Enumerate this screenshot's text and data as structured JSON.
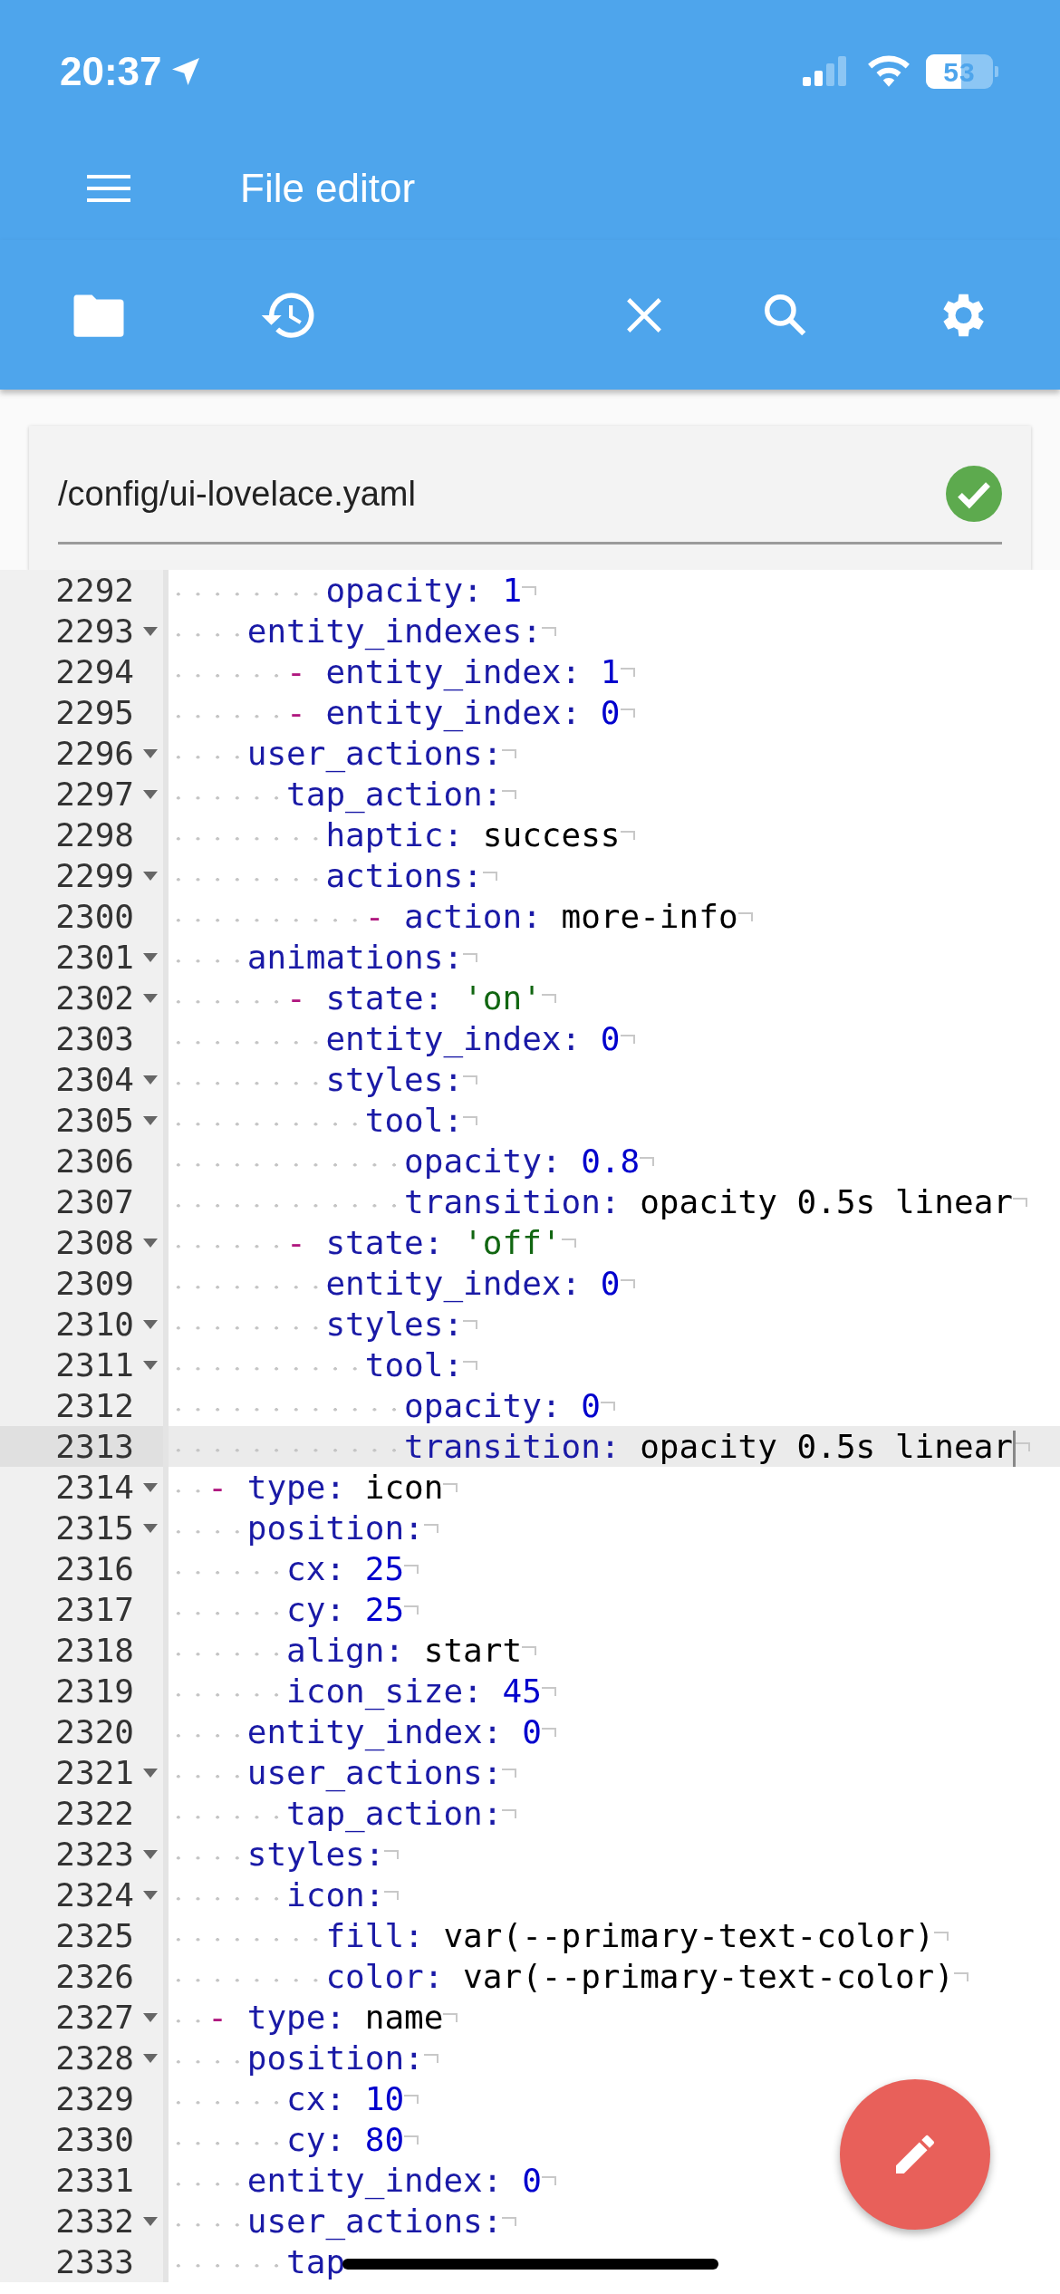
{
  "status_bar": {
    "time": "20:37",
    "battery": "53"
  },
  "app_bar": {
    "title": "File editor"
  },
  "file": {
    "path": "/config/ui-lovelace.yaml",
    "valid": true
  },
  "editor": {
    "lines": [
      {
        "number": "2292",
        "fold": false,
        "active": false,
        "tokens": [
          {
            "kind": "key",
            "text": "        opacity:"
          },
          {
            "kind": "number",
            "text": " 1"
          }
        ]
      },
      {
        "number": "2293",
        "fold": true,
        "active": false,
        "tokens": [
          {
            "kind": "key",
            "text": "    entity_indexes:"
          }
        ]
      },
      {
        "number": "2294",
        "fold": false,
        "active": false,
        "tokens": [
          {
            "kind": "dash",
            "text": "      - "
          },
          {
            "kind": "key",
            "text": "entity_index:"
          },
          {
            "kind": "number",
            "text": " 1"
          }
        ]
      },
      {
        "number": "2295",
        "fold": false,
        "active": false,
        "tokens": [
          {
            "kind": "dash",
            "text": "      - "
          },
          {
            "kind": "key",
            "text": "entity_index:"
          },
          {
            "kind": "number",
            "text": " 0"
          }
        ]
      },
      {
        "number": "2296",
        "fold": true,
        "active": false,
        "tokens": [
          {
            "kind": "key",
            "text": "    user_actions:"
          }
        ]
      },
      {
        "number": "2297",
        "fold": true,
        "active": false,
        "tokens": [
          {
            "kind": "key",
            "text": "      tap_action:"
          }
        ]
      },
      {
        "number": "2298",
        "fold": false,
        "active": false,
        "tokens": [
          {
            "kind": "key",
            "text": "        haptic:"
          },
          {
            "kind": "plain",
            "text": " success"
          }
        ]
      },
      {
        "number": "2299",
        "fold": true,
        "active": false,
        "tokens": [
          {
            "kind": "key",
            "text": "        actions:"
          }
        ]
      },
      {
        "number": "2300",
        "fold": false,
        "active": false,
        "tokens": [
          {
            "kind": "dash",
            "text": "          - "
          },
          {
            "kind": "key",
            "text": "action:"
          },
          {
            "kind": "plain",
            "text": " more-info"
          }
        ]
      },
      {
        "number": "2301",
        "fold": true,
        "active": false,
        "tokens": [
          {
            "kind": "key",
            "text": "    animations:"
          }
        ]
      },
      {
        "number": "2302",
        "fold": true,
        "active": false,
        "tokens": [
          {
            "kind": "dash",
            "text": "      - "
          },
          {
            "kind": "key",
            "text": "state:"
          },
          {
            "kind": "string",
            "text": " 'on'"
          }
        ]
      },
      {
        "number": "2303",
        "fold": false,
        "active": false,
        "tokens": [
          {
            "kind": "key",
            "text": "        entity_index:"
          },
          {
            "kind": "number",
            "text": " 0"
          }
        ]
      },
      {
        "number": "2304",
        "fold": true,
        "active": false,
        "tokens": [
          {
            "kind": "key",
            "text": "        styles:"
          }
        ]
      },
      {
        "number": "2305",
        "fold": true,
        "active": false,
        "tokens": [
          {
            "kind": "key",
            "text": "          tool:"
          }
        ]
      },
      {
        "number": "2306",
        "fold": false,
        "active": false,
        "tokens": [
          {
            "kind": "key",
            "text": "            opacity:"
          },
          {
            "kind": "number",
            "text": " 0.8"
          }
        ]
      },
      {
        "number": "2307",
        "fold": false,
        "active": false,
        "tokens": [
          {
            "kind": "key",
            "text": "            transition:"
          },
          {
            "kind": "plain",
            "text": " opacity 0.5s linear"
          }
        ]
      },
      {
        "number": "2308",
        "fold": true,
        "active": false,
        "tokens": [
          {
            "kind": "dash",
            "text": "      - "
          },
          {
            "kind": "key",
            "text": "state:"
          },
          {
            "kind": "string",
            "text": " 'off'"
          }
        ]
      },
      {
        "number": "2309",
        "fold": false,
        "active": false,
        "tokens": [
          {
            "kind": "key",
            "text": "        entity_index:"
          },
          {
            "kind": "number",
            "text": " 0"
          }
        ]
      },
      {
        "number": "2310",
        "fold": true,
        "active": false,
        "tokens": [
          {
            "kind": "key",
            "text": "        styles:"
          }
        ]
      },
      {
        "number": "2311",
        "fold": true,
        "active": false,
        "tokens": [
          {
            "kind": "key",
            "text": "          tool:"
          }
        ]
      },
      {
        "number": "2312",
        "fold": false,
        "active": false,
        "tokens": [
          {
            "kind": "key",
            "text": "            opacity:"
          },
          {
            "kind": "number",
            "text": " 0"
          }
        ]
      },
      {
        "number": "2313",
        "fold": false,
        "active": true,
        "tokens": [
          {
            "kind": "key",
            "text": "            transition:"
          },
          {
            "kind": "plain",
            "text": " opacity 0.5s linear"
          }
        ]
      },
      {
        "number": "2314",
        "fold": true,
        "active": false,
        "tokens": [
          {
            "kind": "dash",
            "text": "  - "
          },
          {
            "kind": "key",
            "text": "type:"
          },
          {
            "kind": "plain",
            "text": " icon"
          }
        ]
      },
      {
        "number": "2315",
        "fold": true,
        "active": false,
        "tokens": [
          {
            "kind": "key",
            "text": "    position:"
          }
        ]
      },
      {
        "number": "2316",
        "fold": false,
        "active": false,
        "tokens": [
          {
            "kind": "key",
            "text": "      cx:"
          },
          {
            "kind": "number",
            "text": " 25"
          }
        ]
      },
      {
        "number": "2317",
        "fold": false,
        "active": false,
        "tokens": [
          {
            "kind": "key",
            "text": "      cy:"
          },
          {
            "kind": "number",
            "text": " 25"
          }
        ]
      },
      {
        "number": "2318",
        "fold": false,
        "active": false,
        "tokens": [
          {
            "kind": "key",
            "text": "      align:"
          },
          {
            "kind": "plain",
            "text": " start"
          }
        ]
      },
      {
        "number": "2319",
        "fold": false,
        "active": false,
        "tokens": [
          {
            "kind": "key",
            "text": "      icon_size:"
          },
          {
            "kind": "number",
            "text": " 45"
          }
        ]
      },
      {
        "number": "2320",
        "fold": false,
        "active": false,
        "tokens": [
          {
            "kind": "key",
            "text": "    entity_index:"
          },
          {
            "kind": "number",
            "text": " 0"
          }
        ]
      },
      {
        "number": "2321",
        "fold": true,
        "active": false,
        "tokens": [
          {
            "kind": "key",
            "text": "    user_actions:"
          }
        ]
      },
      {
        "number": "2322",
        "fold": false,
        "active": false,
        "tokens": [
          {
            "kind": "key",
            "text": "      tap_action:"
          }
        ]
      },
      {
        "number": "2323",
        "fold": true,
        "active": false,
        "tokens": [
          {
            "kind": "key",
            "text": "    styles:"
          }
        ]
      },
      {
        "number": "2324",
        "fold": true,
        "active": false,
        "tokens": [
          {
            "kind": "key",
            "text": "      icon:"
          }
        ]
      },
      {
        "number": "2325",
        "fold": false,
        "active": false,
        "tokens": [
          {
            "kind": "key",
            "text": "        fill:"
          },
          {
            "kind": "plain",
            "text": " var(--primary-text-color)"
          }
        ]
      },
      {
        "number": "2326",
        "fold": false,
        "active": false,
        "tokens": [
          {
            "kind": "key",
            "text": "        color:"
          },
          {
            "kind": "plain",
            "text": " var(--primary-text-color)"
          }
        ]
      },
      {
        "number": "2327",
        "fold": true,
        "active": false,
        "tokens": [
          {
            "kind": "dash",
            "text": "  - "
          },
          {
            "kind": "key",
            "text": "type:"
          },
          {
            "kind": "plain",
            "text": " name"
          }
        ]
      },
      {
        "number": "2328",
        "fold": true,
        "active": false,
        "tokens": [
          {
            "kind": "key",
            "text": "    position:"
          }
        ]
      },
      {
        "number": "2329",
        "fold": false,
        "active": false,
        "tokens": [
          {
            "kind": "key",
            "text": "      cx:"
          },
          {
            "kind": "number",
            "text": " 10"
          }
        ]
      },
      {
        "number": "2330",
        "fold": false,
        "active": false,
        "tokens": [
          {
            "kind": "key",
            "text": "      cy:"
          },
          {
            "kind": "number",
            "text": " 80"
          }
        ]
      },
      {
        "number": "2331",
        "fold": false,
        "active": false,
        "tokens": [
          {
            "kind": "key",
            "text": "    entity_index:"
          },
          {
            "kind": "number",
            "text": " 0"
          }
        ]
      },
      {
        "number": "2332",
        "fold": true,
        "active": false,
        "tokens": [
          {
            "kind": "key",
            "text": "    user_actions:"
          }
        ]
      },
      {
        "number": "2333",
        "fold": false,
        "active": false,
        "end_mark": false,
        "tokens": [
          {
            "kind": "key",
            "text": "      tap"
          }
        ]
      }
    ]
  }
}
